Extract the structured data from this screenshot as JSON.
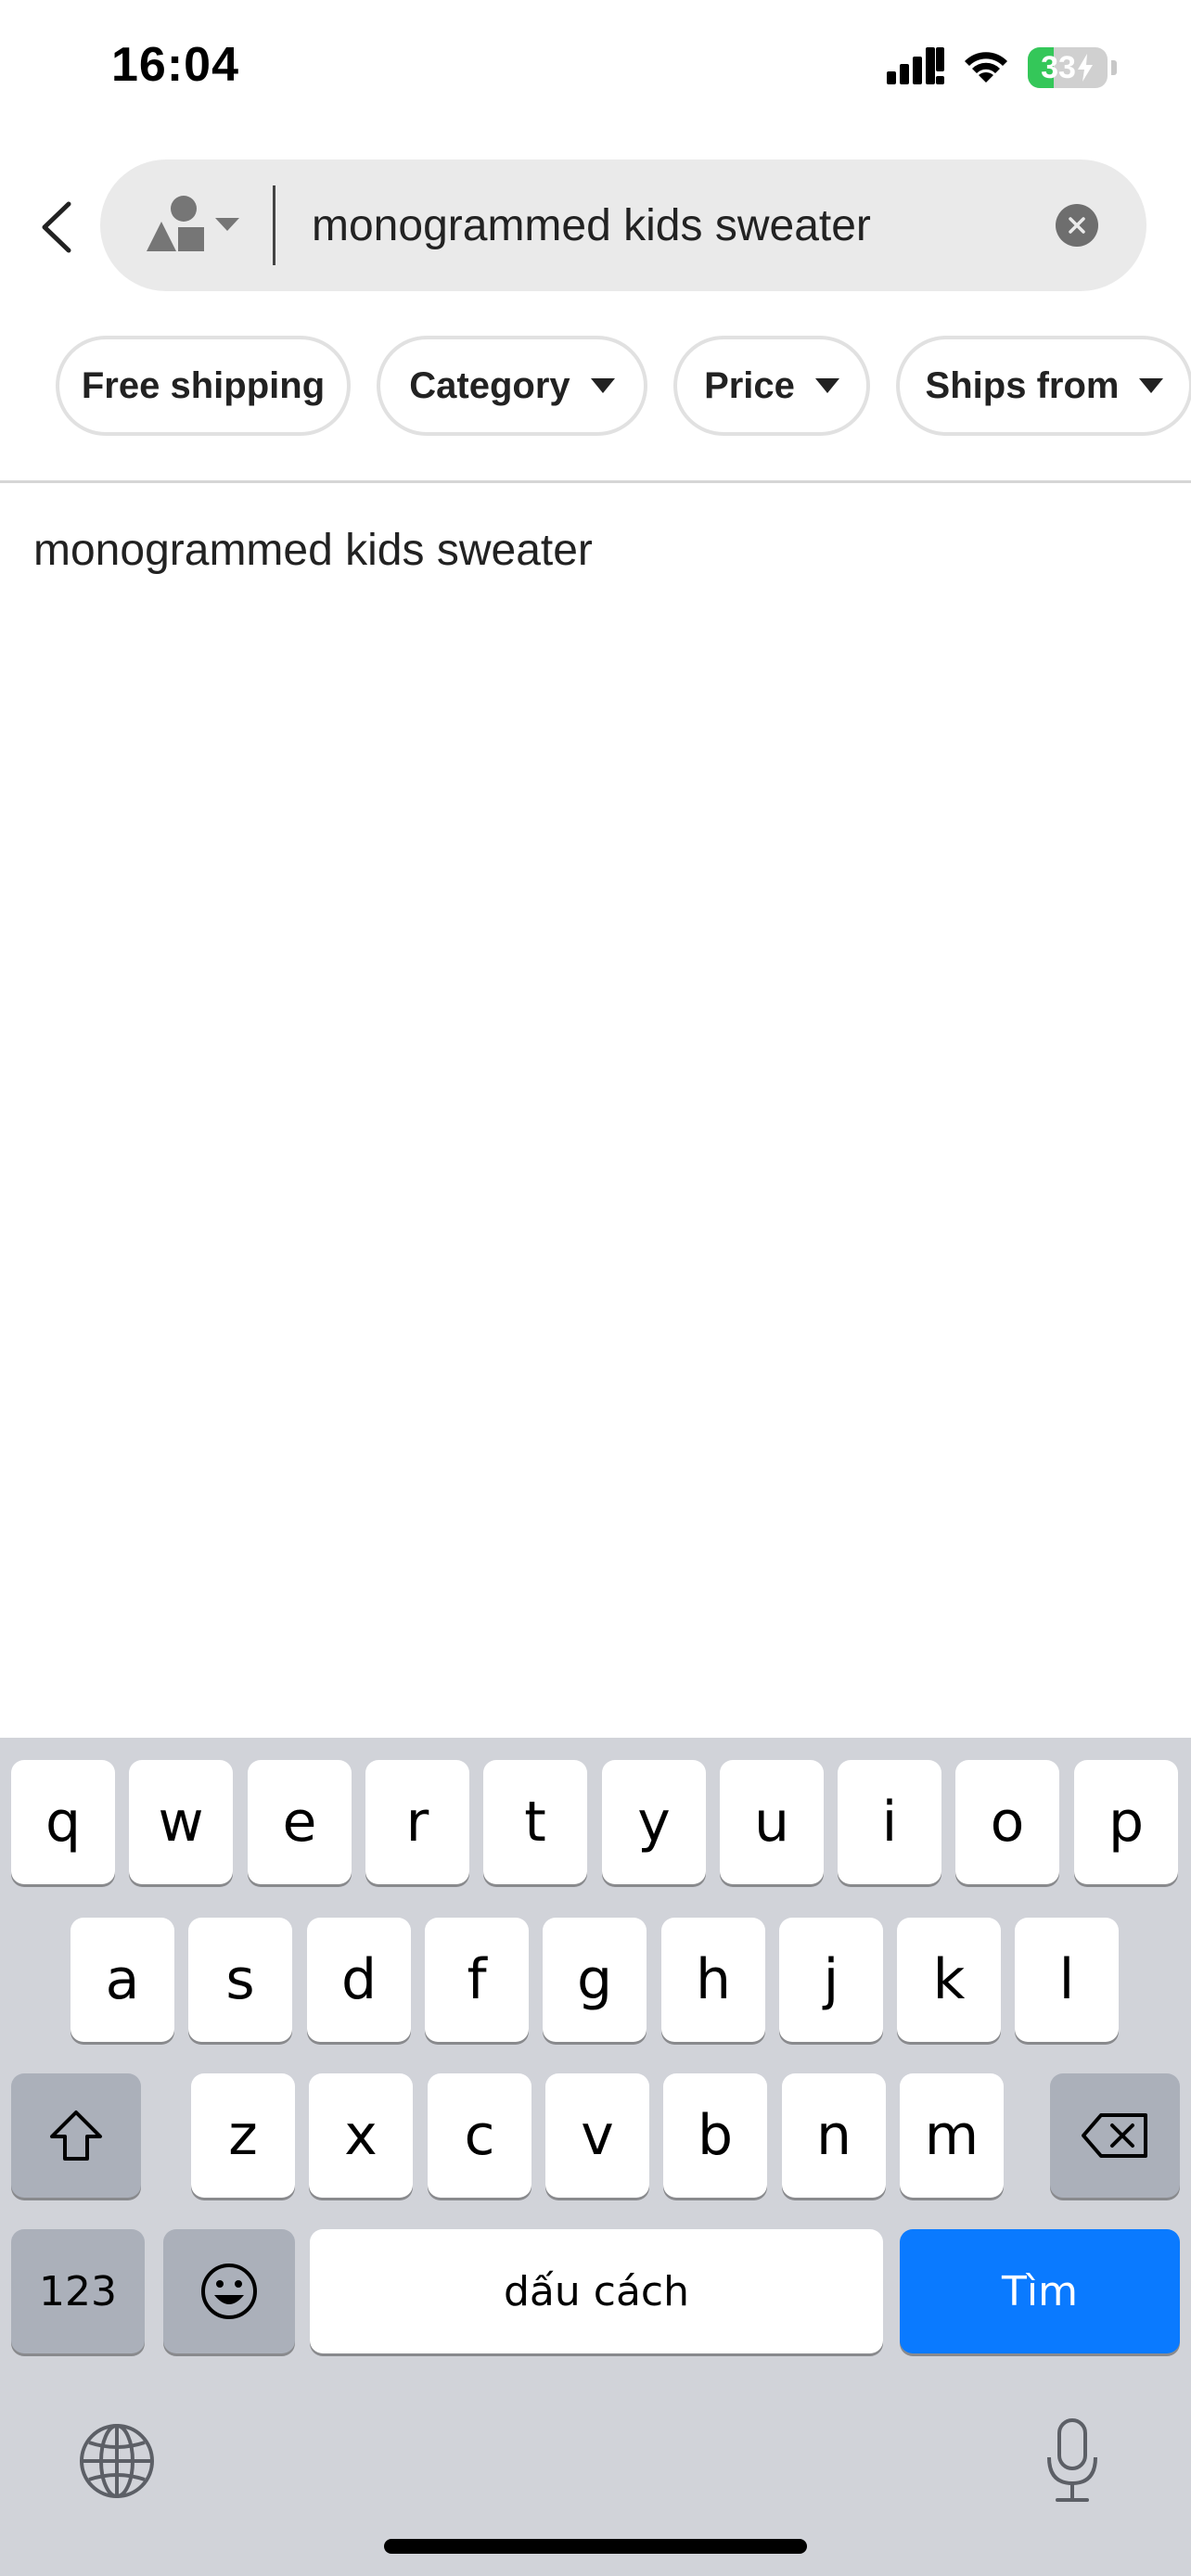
{
  "status_bar": {
    "time": "16:04",
    "battery_level": "33",
    "battery_fraction": 0.33,
    "icons": [
      "cellular-signal-icon",
      "wifi-icon",
      "battery-charging-icon"
    ]
  },
  "search": {
    "value": "monogrammed kids sweater",
    "icons": [
      "back-chevron-icon",
      "category-shapes-icon",
      "clear-icon"
    ]
  },
  "filters": [
    {
      "label": "Free shipping",
      "has_dropdown": false
    },
    {
      "label": "Category",
      "has_dropdown": true
    },
    {
      "label": "Price",
      "has_dropdown": true
    },
    {
      "label": "Ships from",
      "has_dropdown": true
    }
  ],
  "suggestions": [
    "monogrammed kids sweater"
  ],
  "keyboard": {
    "row1": [
      "q",
      "w",
      "e",
      "r",
      "t",
      "y",
      "u",
      "i",
      "o",
      "p"
    ],
    "row2": [
      "a",
      "s",
      "d",
      "f",
      "g",
      "h",
      "j",
      "k",
      "l"
    ],
    "row3": [
      "z",
      "x",
      "c",
      "v",
      "b",
      "n",
      "m"
    ],
    "numbers_label": "123",
    "space_label": "dấu cách",
    "return_label": "Tìm",
    "icons": [
      "shift-icon",
      "backspace-icon",
      "emoji-icon",
      "globe-icon",
      "microphone-icon"
    ]
  },
  "colors": {
    "accent_blue": "#0a7aff",
    "battery_green": "#34c759",
    "keyboard_bg": "#d1d3d9"
  }
}
